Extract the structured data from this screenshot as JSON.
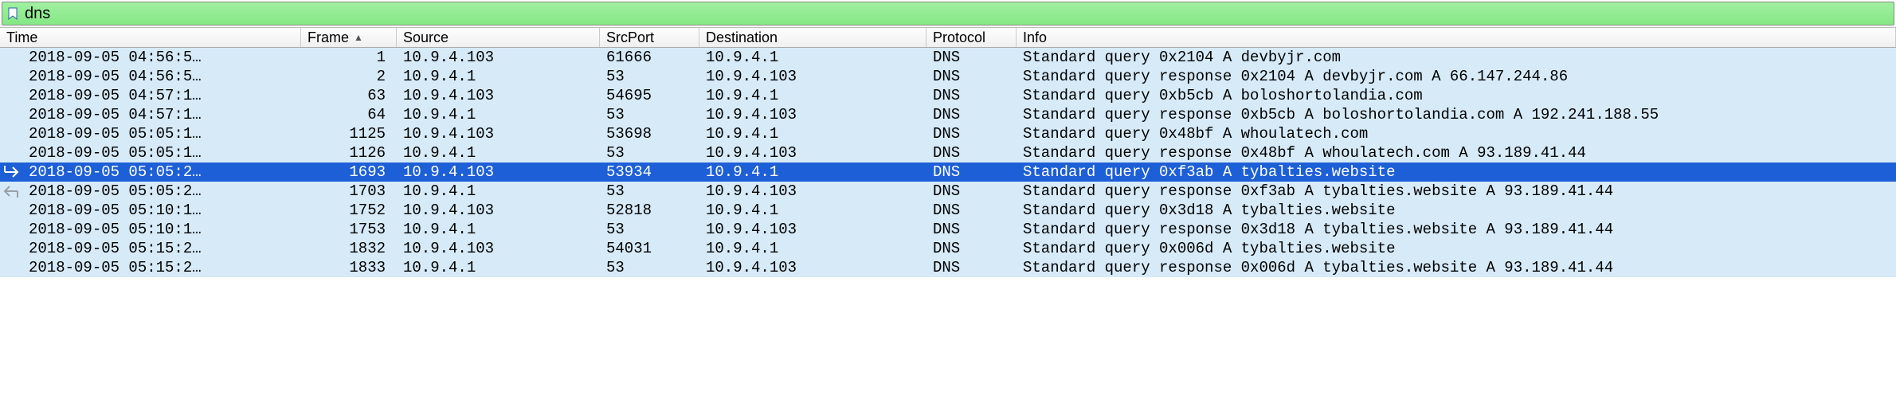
{
  "filter": {
    "value": "dns"
  },
  "columns": {
    "time": "Time",
    "frame": "Frame",
    "source": "Source",
    "srcport": "SrcPort",
    "destination": "Destination",
    "protocol": "Protocol",
    "info": "Info",
    "sort_indicator": "▲"
  },
  "rows": [
    {
      "time": "2018-09-05 04:56:5…",
      "frame": "1",
      "source": "10.9.4.103",
      "srcport": "61666",
      "dest": "10.9.4.1",
      "proto": "DNS",
      "info": "Standard query 0x2104 A devbyjr.com",
      "selected": false,
      "marker": ""
    },
    {
      "time": "2018-09-05 04:56:5…",
      "frame": "2",
      "source": "10.9.4.1",
      "srcport": "53",
      "dest": "10.9.4.103",
      "proto": "DNS",
      "info": "Standard query response 0x2104 A devbyjr.com A 66.147.244.86",
      "selected": false,
      "marker": ""
    },
    {
      "time": "2018-09-05 04:57:1…",
      "frame": "63",
      "source": "10.9.4.103",
      "srcport": "54695",
      "dest": "10.9.4.1",
      "proto": "DNS",
      "info": "Standard query 0xb5cb A boloshortolandia.com",
      "selected": false,
      "marker": ""
    },
    {
      "time": "2018-09-05 04:57:1…",
      "frame": "64",
      "source": "10.9.4.1",
      "srcport": "53",
      "dest": "10.9.4.103",
      "proto": "DNS",
      "info": "Standard query response 0xb5cb A boloshortolandia.com A 192.241.188.55",
      "selected": false,
      "marker": ""
    },
    {
      "time": "2018-09-05 05:05:1…",
      "frame": "1125",
      "source": "10.9.4.103",
      "srcport": "53698",
      "dest": "10.9.4.1",
      "proto": "DNS",
      "info": "Standard query 0x48bf A whoulatech.com",
      "selected": false,
      "marker": ""
    },
    {
      "time": "2018-09-05 05:05:1…",
      "frame": "1126",
      "source": "10.9.4.1",
      "srcport": "53",
      "dest": "10.9.4.103",
      "proto": "DNS",
      "info": "Standard query response 0x48bf A whoulatech.com A 93.189.41.44",
      "selected": false,
      "marker": ""
    },
    {
      "time": "2018-09-05 05:05:2…",
      "frame": "1693",
      "source": "10.9.4.103",
      "srcport": "53934",
      "dest": "10.9.4.1",
      "proto": "DNS",
      "info": "Standard query 0xf3ab A tybalties.website",
      "selected": true,
      "marker": "req"
    },
    {
      "time": "2018-09-05 05:05:2…",
      "frame": "1703",
      "source": "10.9.4.1",
      "srcport": "53",
      "dest": "10.9.4.103",
      "proto": "DNS",
      "info": "Standard query response 0xf3ab A tybalties.website A 93.189.41.44",
      "selected": false,
      "marker": "resp"
    },
    {
      "time": "2018-09-05 05:10:1…",
      "frame": "1752",
      "source": "10.9.4.103",
      "srcport": "52818",
      "dest": "10.9.4.1",
      "proto": "DNS",
      "info": "Standard query 0x3d18 A tybalties.website",
      "selected": false,
      "marker": ""
    },
    {
      "time": "2018-09-05 05:10:1…",
      "frame": "1753",
      "source": "10.9.4.1",
      "srcport": "53",
      "dest": "10.9.4.103",
      "proto": "DNS",
      "info": "Standard query response 0x3d18 A tybalties.website A 93.189.41.44",
      "selected": false,
      "marker": ""
    },
    {
      "time": "2018-09-05 05:15:2…",
      "frame": "1832",
      "source": "10.9.4.103",
      "srcport": "54031",
      "dest": "10.9.4.1",
      "proto": "DNS",
      "info": "Standard query 0x006d A tybalties.website",
      "selected": false,
      "marker": ""
    },
    {
      "time": "2018-09-05 05:15:2…",
      "frame": "1833",
      "source": "10.9.4.1",
      "srcport": "53",
      "dest": "10.9.4.103",
      "proto": "DNS",
      "info": "Standard query response 0x006d A tybalties.website A 93.189.41.44",
      "selected": false,
      "marker": ""
    }
  ]
}
